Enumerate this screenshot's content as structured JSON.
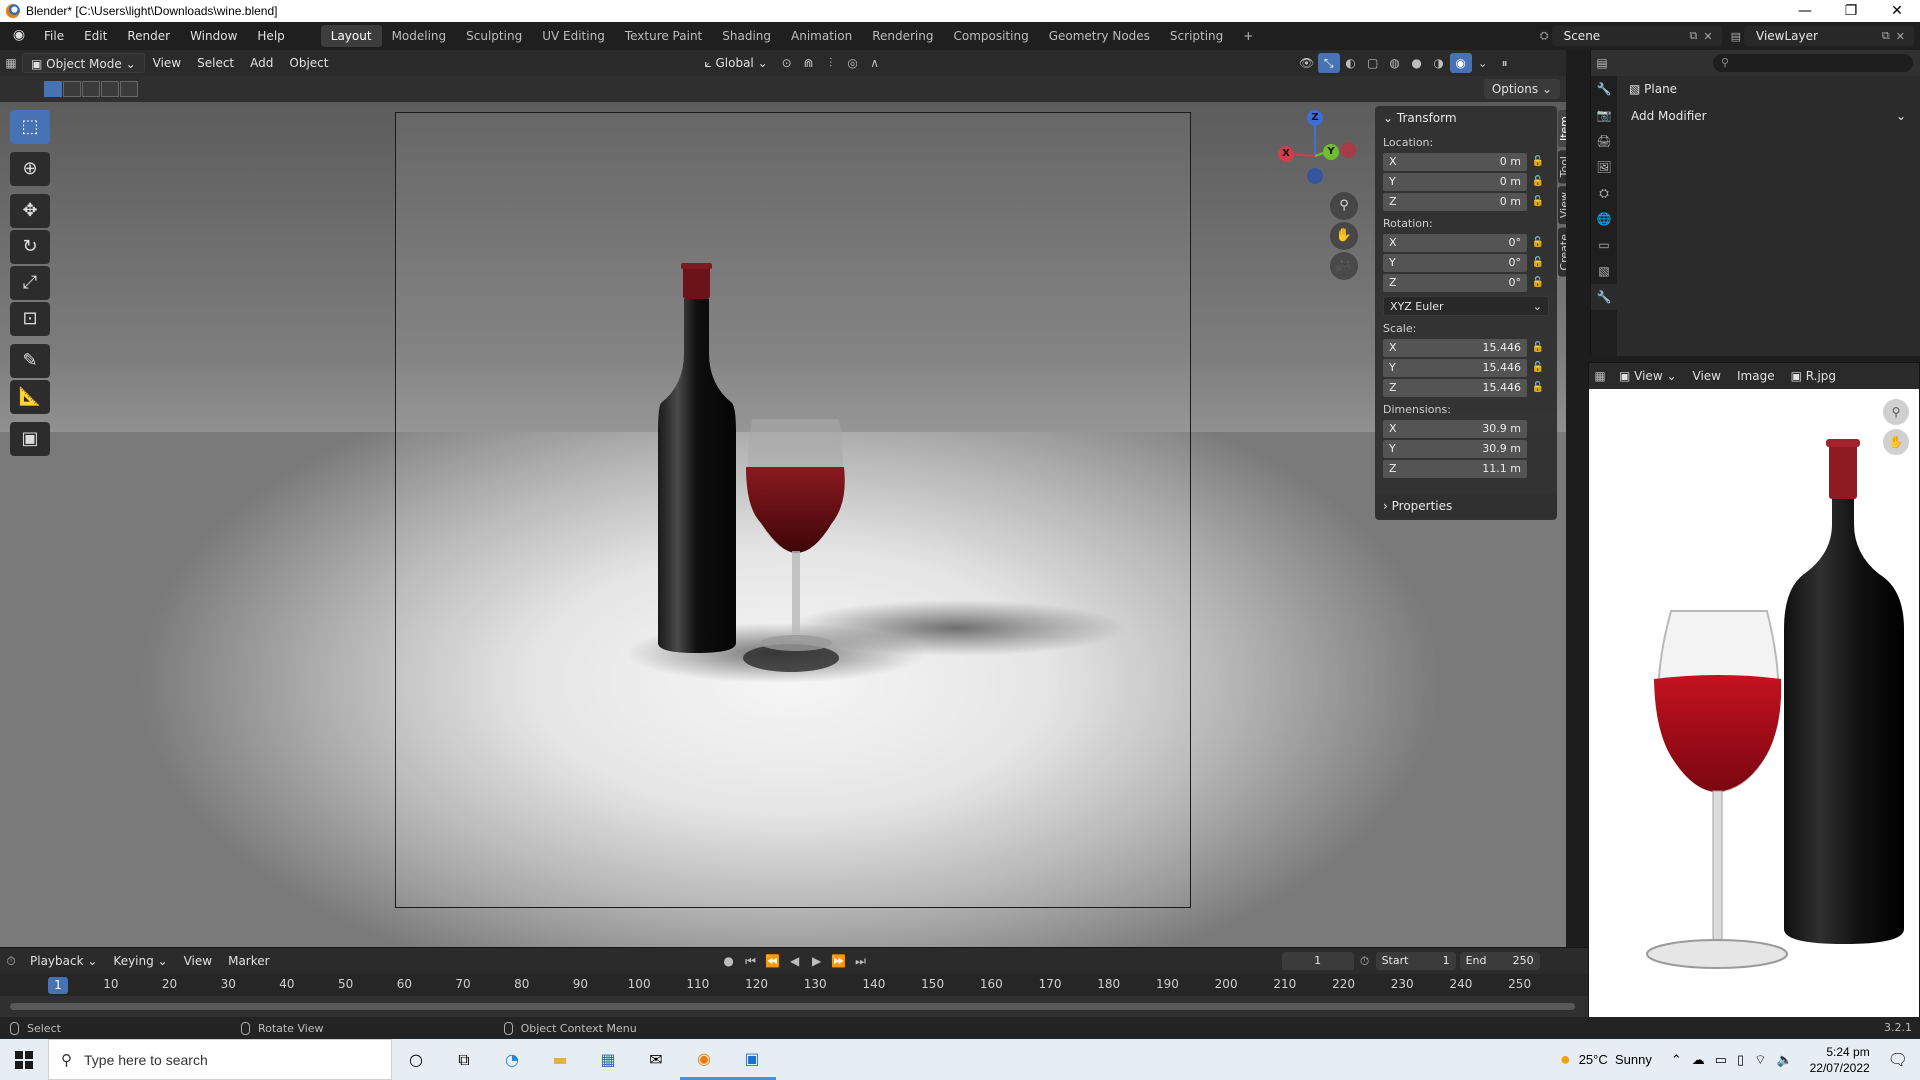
{
  "window": {
    "title": "Blender* [C:\\Users\\light\\Downloads\\wine.blend]",
    "controls": [
      "—",
      "❐",
      "✕"
    ]
  },
  "menus": [
    "File",
    "Edit",
    "Render",
    "Window",
    "Help"
  ],
  "workspaces": [
    "Layout",
    "Modeling",
    "Sculpting",
    "UV Editing",
    "Texture Paint",
    "Shading",
    "Animation",
    "Rendering",
    "Compositing",
    "Geometry Nodes",
    "Scripting",
    "+"
  ],
  "active_workspace": "Layout",
  "scene": "Scene",
  "view_layer": "ViewLayer",
  "viewport_header": {
    "mode": "Object Mode",
    "menus": [
      "View",
      "Select",
      "Add",
      "Object"
    ],
    "orientation": "Global",
    "options": "Options"
  },
  "tools": [
    {
      "name": "select-box-tool",
      "glyph": "⬚"
    },
    {
      "name": "cursor-tool",
      "glyph": "⊕"
    },
    {
      "name": "move-tool",
      "glyph": "✥"
    },
    {
      "name": "rotate-tool",
      "glyph": "↻"
    },
    {
      "name": "scale-tool",
      "glyph": "⤢"
    },
    {
      "name": "transform-tool",
      "glyph": "⊡"
    },
    {
      "name": "annotate-tool",
      "glyph": "✎"
    },
    {
      "name": "measure-tool",
      "glyph": "📐"
    },
    {
      "name": "add-cube-tool",
      "glyph": "▣"
    }
  ],
  "gizmo": {
    "x": "X",
    "y": "Y",
    "z": "Z"
  },
  "npanel": {
    "title": "Transform",
    "location_label": "Location:",
    "location": [
      {
        "axis": "X",
        "value": "0 m"
      },
      {
        "axis": "Y",
        "value": "0 m"
      },
      {
        "axis": "Z",
        "value": "0 m"
      }
    ],
    "rotation_label": "Rotation:",
    "rotation": [
      {
        "axis": "X",
        "value": "0°"
      },
      {
        "axis": "Y",
        "value": "0°"
      },
      {
        "axis": "Z",
        "value": "0°"
      }
    ],
    "rotation_mode": "XYZ Euler",
    "scale_label": "Scale:",
    "scale": [
      {
        "axis": "X",
        "value": "15.446"
      },
      {
        "axis": "Y",
        "value": "15.446"
      },
      {
        "axis": "Z",
        "value": "15.446"
      }
    ],
    "dimensions_label": "Dimensions:",
    "dimensions": [
      {
        "axis": "X",
        "value": "30.9 m"
      },
      {
        "axis": "Y",
        "value": "30.9 m"
      },
      {
        "axis": "Z",
        "value": "11.1 m"
      }
    ],
    "properties": "Properties",
    "tabs": [
      "Item",
      "Tool",
      "View",
      "Create"
    ]
  },
  "properties_editor": {
    "object_name": "Plane",
    "add_modifier": "Add Modifier"
  },
  "image_editor": {
    "menus": [
      "View",
      "View",
      "Image"
    ],
    "image_name": "R.jpg"
  },
  "timeline": {
    "menus": [
      "Playback",
      "Keying",
      "View",
      "Marker"
    ],
    "current_frame": "1",
    "start_label": "Start",
    "start": "1",
    "end_label": "End",
    "end": "250",
    "ticks": [
      "10",
      "20",
      "30",
      "40",
      "50",
      "60",
      "70",
      "80",
      "90",
      "100",
      "110",
      "120",
      "130",
      "140",
      "150",
      "160",
      "170",
      "180",
      "190",
      "200",
      "210",
      "220",
      "230",
      "240",
      "250"
    ],
    "frame_indicator": "1"
  },
  "statusbar": {
    "select": "Select",
    "rotate": "Rotate View",
    "context": "Object Context Menu",
    "version": "3.2.1"
  },
  "taskbar": {
    "search_placeholder": "Type here to search",
    "weather": "25°C  Sunny",
    "time": "5:24 pm",
    "date": "22/07/2022"
  }
}
